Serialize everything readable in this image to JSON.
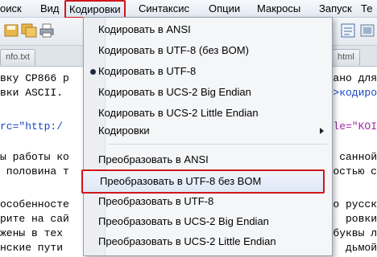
{
  "menubar": {
    "items": [
      {
        "label": "оиск"
      },
      {
        "label": "Вид"
      },
      {
        "label": "Кодировки"
      },
      {
        "label": "Синтаксис"
      },
      {
        "label": "Опции"
      },
      {
        "label": "Макросы"
      },
      {
        "label": "Запуск"
      },
      {
        "label": "Те"
      }
    ],
    "active_index": 2
  },
  "tabs": [
    {
      "label": "nfo.txt"
    },
    {
      "label": "html"
    }
  ],
  "editor": {
    "lines": [
      "вку CP866 р",
      "вки ASCII.",
      "rc=\"http:/",
      "ы работы ко",
      " половина т",
      "особенносте",
      "рите на сай",
      "жены в тех",
      "нские пути"
    ],
    "right_fragments": [
      "ровано для",
      "ong>кодиро",
      "le=\"KOI",
      "санной",
      "ностью с",
      "о русск",
      "ровки",
      "буквы л",
      "дьмой"
    ]
  },
  "dropdown": {
    "items": [
      {
        "label": "Кодировать в ANSI"
      },
      {
        "label": "Кодировать в UTF-8 (без BOM)"
      },
      {
        "label": "Кодировать в UTF-8",
        "checked": true
      },
      {
        "label": "Кодировать в UCS-2 Big Endian"
      },
      {
        "label": "Кодировать в UCS-2 Little Endian"
      },
      {
        "label": "Кодировки",
        "submenu": true
      },
      {
        "label": "Преобразовать в ANSI"
      },
      {
        "label": "Преобразовать в UTF-8 без BOM",
        "highlighted": true
      },
      {
        "label": "Преобразовать в UTF-8"
      },
      {
        "label": "Преобразовать в UCS-2 Big Endian"
      },
      {
        "label": "Преобразовать в UCS-2 Little Endian"
      }
    ]
  },
  "colors": {
    "highlight_border": "#d0161b",
    "keyword_blue": "#1b46c6",
    "string_purple": "#9b28a0"
  },
  "icons": [
    "save-icon",
    "save-all-icon",
    "close-file-icon",
    "print-icon",
    "view-icon",
    "macro-icon"
  ]
}
